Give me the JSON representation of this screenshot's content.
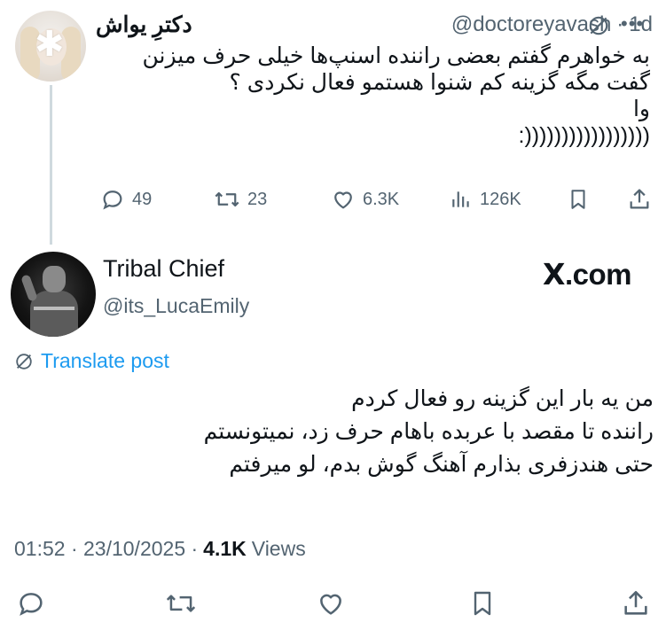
{
  "tweet1": {
    "display_name": "دکترِ یواش",
    "handle": "@doctoreyavash",
    "time": "1d",
    "body_lines": [
      "به خواهرم گفتم بعضی راننده اسنپ‌ها خیلی حرف میزنن",
      "گفت مگه گزینه کم شنوا هستمو فعال نکردی ؟",
      "وا",
      "(((((((((((((((((:"
    ],
    "actions": {
      "replies": "49",
      "reposts": "23",
      "likes": "6.3K",
      "views": "126K"
    },
    "icons": [
      "translate-icon",
      "more-icon",
      "reply-icon",
      "repost-icon",
      "like-icon",
      "views-icon",
      "bookmark-icon",
      "share-icon"
    ]
  },
  "tweet2": {
    "display_name": "Tribal Chief",
    "handle": "@its_LucaEmily",
    "watermark": "X.com",
    "translate_label": "Translate post",
    "body_lines": [
      "من یه بار این گزینه رو فعال کردم",
      "راننده تا مقصد با عربده باهام حرف زد، نمیتونستم",
      "حتی هندزفری بذارم آهنگ گوش بدم، لو میرفتم"
    ],
    "timestamp": "01:52 · 23/10/2025 ·",
    "views_count": "4.1K",
    "views_label": "Views"
  },
  "colors": {
    "text": "#0f1419",
    "muted": "#536471",
    "link": "#1d9bf0",
    "thread_line": "#cfd9de"
  }
}
